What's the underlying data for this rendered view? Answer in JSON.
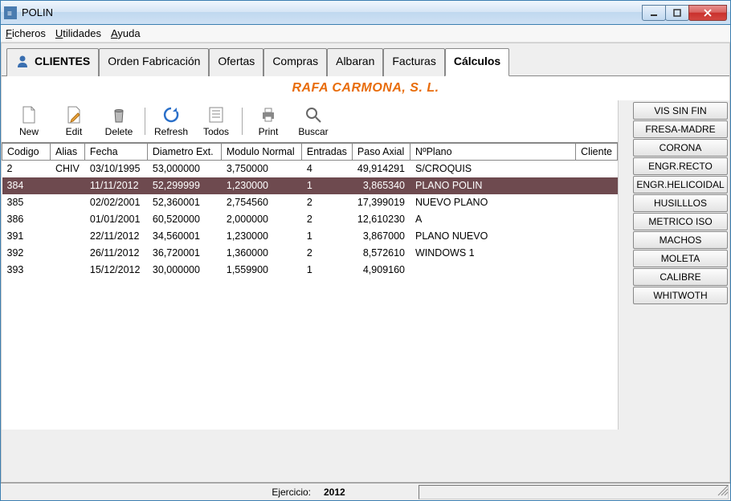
{
  "window": {
    "title": "POLIN"
  },
  "menu": {
    "ficheros": "Ficheros",
    "utilidades": "Utilidades",
    "ayuda": "Ayuda"
  },
  "tabs": [
    {
      "label": "CLIENTES"
    },
    {
      "label": "Orden Fabricación"
    },
    {
      "label": "Ofertas"
    },
    {
      "label": "Compras"
    },
    {
      "label": "Albaran"
    },
    {
      "label": "Facturas"
    },
    {
      "label": "Cálculos"
    }
  ],
  "company": "RAFA CARMONA, S. L.",
  "toolbar": {
    "new": "New",
    "edit": "Edit",
    "delete": "Delete",
    "refresh": "Refresh",
    "todos": "Todos",
    "print": "Print",
    "buscar": "Buscar"
  },
  "columns": {
    "codigo": "Codigo",
    "alias": "Alias",
    "fecha": "Fecha",
    "diam": "Diametro Ext.",
    "modulo": "Modulo Normal",
    "entradas": "Entradas",
    "paso": "Paso Axial",
    "plano": "NºPlano",
    "cliente": "Cliente"
  },
  "rows": [
    {
      "codigo": "2",
      "alias": "CHIV",
      "fecha": "03/10/1995",
      "diam": "53,000000",
      "modulo": "3,750000",
      "entradas": "4",
      "paso": "49,914291",
      "plano": "S/CROQUIS",
      "sel": false
    },
    {
      "codigo": "384",
      "alias": "",
      "fecha": "11/11/2012",
      "diam": "52,299999",
      "modulo": "1,230000",
      "entradas": "1",
      "paso": "3,865340",
      "plano": "PLANO POLIN",
      "sel": true
    },
    {
      "codigo": "385",
      "alias": "",
      "fecha": "02/02/2001",
      "diam": "52,360001",
      "modulo": "2,754560",
      "entradas": "2",
      "paso": "17,399019",
      "plano": "NUEVO PLANO",
      "sel": false
    },
    {
      "codigo": "386",
      "alias": "",
      "fecha": "01/01/2001",
      "diam": "60,520000",
      "modulo": "2,000000",
      "entradas": "2",
      "paso": "12,610230",
      "plano": "A",
      "sel": false
    },
    {
      "codigo": "391",
      "alias": "",
      "fecha": "22/11/2012",
      "diam": "34,560001",
      "modulo": "1,230000",
      "entradas": "1",
      "paso": "3,867000",
      "plano": "PLANO NUEVO",
      "sel": false
    },
    {
      "codigo": "392",
      "alias": "",
      "fecha": "26/11/2012",
      "diam": "36,720001",
      "modulo": "1,360000",
      "entradas": "2",
      "paso": "8,572610",
      "plano": "WINDOWS 1",
      "sel": false
    },
    {
      "codigo": "393",
      "alias": "",
      "fecha": "15/12/2012",
      "diam": "30,000000",
      "modulo": "1,559900",
      "entradas": "1",
      "paso": "4,909160",
      "plano": "",
      "sel": false
    }
  ],
  "rail": [
    "VIS SIN FIN",
    "FRESA-MADRE",
    "CORONA",
    "ENGR.RECTO",
    "ENGR.HELICOIDAL",
    "HUSILLLOS",
    "METRICO ISO",
    "MACHOS",
    "MOLETA",
    "CALIBRE",
    "WHITWOTH"
  ],
  "status": {
    "label": "Ejercicio:",
    "value": "2012"
  }
}
